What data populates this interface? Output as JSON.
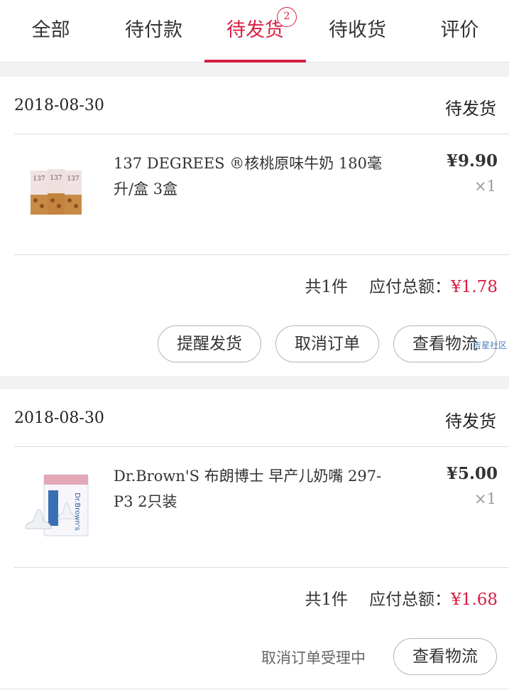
{
  "tabs": [
    {
      "label": "全部"
    },
    {
      "label": "待付款"
    },
    {
      "label": "待发货",
      "badge": "2"
    },
    {
      "label": "待收货"
    },
    {
      "label": "评价"
    }
  ],
  "orders": [
    {
      "date": "2018-08-30",
      "status": "待发货",
      "product": {
        "name": "137 DEGREES ®核桃原味牛奶 180毫升/盒 3盒",
        "price": "¥9.90",
        "qty": "×1"
      },
      "count_label": "共1件",
      "total_label": "应付总额：",
      "total_amount": "¥1.78",
      "buttons": {
        "remind": "提醒发货",
        "cancel": "取消订单",
        "track": "查看物流"
      }
    },
    {
      "date": "2018-08-30",
      "status": "待发货",
      "product": {
        "name": "Dr.Brown'S 布朗博士 早产儿奶嘴 297-P3 2只装",
        "price": "¥5.00",
        "qty": "×1"
      },
      "count_label": "共1件",
      "total_label": "应付总额：",
      "total_amount": "¥1.68",
      "cancel_note": "取消订单受理中",
      "buttons": {
        "track": "查看物流"
      }
    }
  ],
  "watermark": "吉星社区",
  "colors": {
    "accent": "#d81e43",
    "background": "#f2f2f2"
  }
}
